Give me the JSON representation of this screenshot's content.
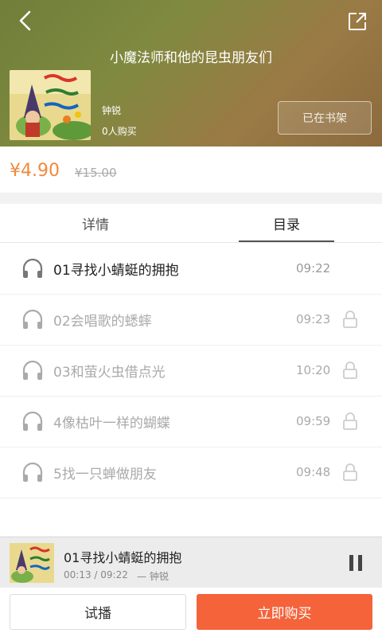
{
  "header": {
    "title": "小魔法师和他的昆虫朋友们",
    "author": "钟锐",
    "buyers": "0人购买",
    "shelf_label": "已在书架"
  },
  "pricing": {
    "price": "¥4.90",
    "original_price": "¥15.00"
  },
  "tabs": [
    {
      "label": "详情"
    },
    {
      "label": "目录"
    }
  ],
  "tracks": [
    {
      "title": "01寻找小蜻蜓的拥抱",
      "duration": "09:22"
    },
    {
      "title": "02会唱歌的蟋蟀",
      "duration": "09:23"
    },
    {
      "title": "03和萤火虫借点光",
      "duration": "10:20"
    },
    {
      "title": "4像枯叶一样的蝴蝶",
      "duration": "09:59"
    },
    {
      "title": "5找一只蝉做朋友",
      "duration": "09:48"
    }
  ],
  "player": {
    "title": "01寻找小蜻蜓的拥抱",
    "time": "00:13 / 09:22",
    "author": "— 钟锐"
  },
  "actions": {
    "trial_label": "试播",
    "buy_label": "立即购买"
  },
  "colors": {
    "accent_orange": "#f08a3c",
    "buy_button": "#f4633a"
  }
}
